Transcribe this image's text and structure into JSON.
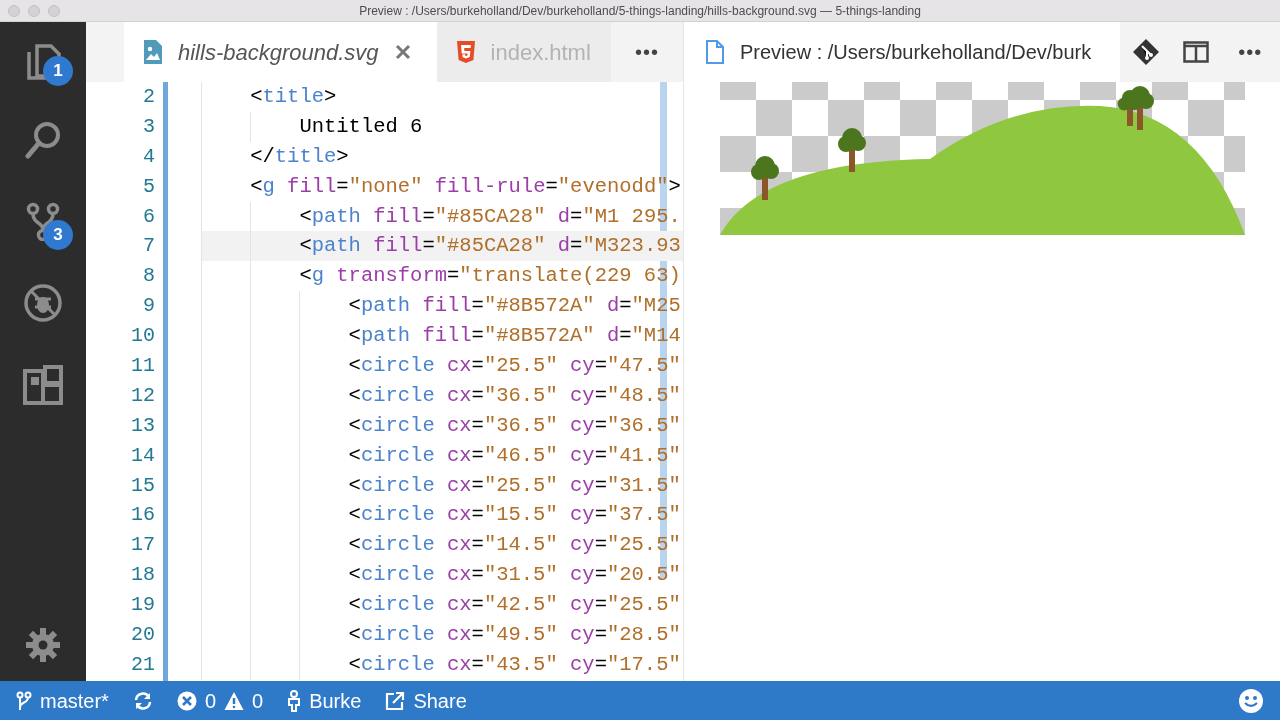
{
  "window": {
    "title": "Preview : /Users/burkeholland/Dev/burkeholland/5-things-landing/hills-background.svg — 5-things-landing"
  },
  "activity_bar": {
    "items": [
      {
        "kind": "files",
        "badge": "1"
      },
      {
        "kind": "search"
      },
      {
        "kind": "scm",
        "badge": "3"
      },
      {
        "kind": "debug"
      },
      {
        "kind": "extensions"
      }
    ]
  },
  "editor": {
    "tabs": [
      {
        "label": "hills-background.svg",
        "kind": "image",
        "selected": true,
        "preview": true
      },
      {
        "label": "index.html",
        "kind": "html",
        "selected": false,
        "preview": false
      }
    ],
    "more": "•••",
    "lines": [
      {
        "number": "2",
        "tokens": [
          {
            "kind": "p",
            "s": "<"
          },
          {
            "kind": "tag",
            "s": "title"
          },
          {
            "kind": "p",
            "s": ">"
          }
        ],
        "children": [
          {
            "number": "3",
            "tokens": [
              {
                "kind": "text",
                "s": "Untitled 6"
              }
            ]
          }
        ]
      },
      {
        "number": "4",
        "tokens": [
          {
            "kind": "p",
            "s": "</"
          },
          {
            "kind": "tag",
            "s": "title"
          },
          {
            "kind": "p",
            "s": ">"
          }
        ]
      },
      {
        "number": "5",
        "tokens": [
          {
            "kind": "p",
            "s": "<"
          },
          {
            "kind": "tag",
            "s": "g"
          },
          {
            "kind": "attr",
            "s": " fill"
          },
          {
            "kind": "p",
            "s": "="
          },
          {
            "kind": "str",
            "s": "\"none\""
          },
          {
            "kind": "attr",
            "s": " fill-rule"
          },
          {
            "kind": "p",
            "s": "="
          },
          {
            "kind": "str",
            "s": "\"evenodd\""
          },
          {
            "kind": "p",
            "s": ">"
          }
        ],
        "children": [
          {
            "number": "6",
            "tokens": [
              {
                "kind": "p",
                "s": "<"
              },
              {
                "kind": "tag",
                "s": "path"
              },
              {
                "kind": "attr",
                "s": " fill"
              },
              {
                "kind": "p",
                "s": "="
              },
              {
                "kind": "str",
                "s": "\"#85CA28\""
              },
              {
                "kind": "attr",
                "s": " d"
              },
              {
                "kind": "p",
                "s": "="
              },
              {
                "kind": "str",
                "s": "\"M1 295."
              }
            ]
          },
          {
            "number": "7",
            "current": true,
            "tokens": [
              {
                "kind": "p",
                "s": "<"
              },
              {
                "kind": "tag",
                "s": "path"
              },
              {
                "kind": "attr",
                "s": " fill"
              },
              {
                "kind": "p",
                "s": "="
              },
              {
                "kind": "str",
                "s": "\"#85CA28\""
              },
              {
                "kind": "attr",
                "s": " d"
              },
              {
                "kind": "p",
                "s": "="
              },
              {
                "kind": "str",
                "s": "\"M323.93"
              }
            ]
          },
          {
            "number": "8",
            "tokens": [
              {
                "kind": "p",
                "s": "<"
              },
              {
                "kind": "tag",
                "s": "g"
              },
              {
                "kind": "attr",
                "s": " transform"
              },
              {
                "kind": "p",
                "s": "="
              },
              {
                "kind": "str",
                "s": "\"translate(229 63)"
              }
            ],
            "children": [
              {
                "number": "9",
                "tokens": [
                  {
                    "kind": "p",
                    "s": "<"
                  },
                  {
                    "kind": "tag",
                    "s": "path"
                  },
                  {
                    "kind": "attr",
                    "s": " fill"
                  },
                  {
                    "kind": "p",
                    "s": "="
                  },
                  {
                    "kind": "str",
                    "s": "\"#8B572A\""
                  },
                  {
                    "kind": "attr",
                    "s": " d"
                  },
                  {
                    "kind": "p",
                    "s": "="
                  },
                  {
                    "kind": "str",
                    "s": "\"M25"
                  }
                ]
              },
              {
                "number": "10",
                "tokens": [
                  {
                    "kind": "p",
                    "s": "<"
                  },
                  {
                    "kind": "tag",
                    "s": "path"
                  },
                  {
                    "kind": "attr",
                    "s": " fill"
                  },
                  {
                    "kind": "p",
                    "s": "="
                  },
                  {
                    "kind": "str",
                    "s": "\"#8B572A\""
                  },
                  {
                    "kind": "attr",
                    "s": " d"
                  },
                  {
                    "kind": "p",
                    "s": "="
                  },
                  {
                    "kind": "str",
                    "s": "\"M14"
                  }
                ]
              },
              {
                "number": "11",
                "tokens": [
                  {
                    "kind": "p",
                    "s": "<"
                  },
                  {
                    "kind": "tag",
                    "s": "circle"
                  },
                  {
                    "kind": "attr",
                    "s": " cx"
                  },
                  {
                    "kind": "p",
                    "s": "="
                  },
                  {
                    "kind": "str",
                    "s": "\"25.5\""
                  },
                  {
                    "kind": "attr",
                    "s": " cy"
                  },
                  {
                    "kind": "p",
                    "s": "="
                  },
                  {
                    "kind": "str",
                    "s": "\"47.5\""
                  }
                ]
              },
              {
                "number": "12",
                "tokens": [
                  {
                    "kind": "p",
                    "s": "<"
                  },
                  {
                    "kind": "tag",
                    "s": "circle"
                  },
                  {
                    "kind": "attr",
                    "s": " cx"
                  },
                  {
                    "kind": "p",
                    "s": "="
                  },
                  {
                    "kind": "str",
                    "s": "\"36.5\""
                  },
                  {
                    "kind": "attr",
                    "s": " cy"
                  },
                  {
                    "kind": "p",
                    "s": "="
                  },
                  {
                    "kind": "str",
                    "s": "\"48.5\""
                  }
                ]
              },
              {
                "number": "13",
                "tokens": [
                  {
                    "kind": "p",
                    "s": "<"
                  },
                  {
                    "kind": "tag",
                    "s": "circle"
                  },
                  {
                    "kind": "attr",
                    "s": " cx"
                  },
                  {
                    "kind": "p",
                    "s": "="
                  },
                  {
                    "kind": "str",
                    "s": "\"36.5\""
                  },
                  {
                    "kind": "attr",
                    "s": " cy"
                  },
                  {
                    "kind": "p",
                    "s": "="
                  },
                  {
                    "kind": "str",
                    "s": "\"36.5\""
                  }
                ]
              },
              {
                "number": "14",
                "tokens": [
                  {
                    "kind": "p",
                    "s": "<"
                  },
                  {
                    "kind": "tag",
                    "s": "circle"
                  },
                  {
                    "kind": "attr",
                    "s": " cx"
                  },
                  {
                    "kind": "p",
                    "s": "="
                  },
                  {
                    "kind": "str",
                    "s": "\"46.5\""
                  },
                  {
                    "kind": "attr",
                    "s": " cy"
                  },
                  {
                    "kind": "p",
                    "s": "="
                  },
                  {
                    "kind": "str",
                    "s": "\"41.5\""
                  }
                ]
              },
              {
                "number": "15",
                "tokens": [
                  {
                    "kind": "p",
                    "s": "<"
                  },
                  {
                    "kind": "tag",
                    "s": "circle"
                  },
                  {
                    "kind": "attr",
                    "s": " cx"
                  },
                  {
                    "kind": "p",
                    "s": "="
                  },
                  {
                    "kind": "str",
                    "s": "\"25.5\""
                  },
                  {
                    "kind": "attr",
                    "s": " cy"
                  },
                  {
                    "kind": "p",
                    "s": "="
                  },
                  {
                    "kind": "str",
                    "s": "\"31.5\""
                  }
                ]
              },
              {
                "number": "16",
                "tokens": [
                  {
                    "kind": "p",
                    "s": "<"
                  },
                  {
                    "kind": "tag",
                    "s": "circle"
                  },
                  {
                    "kind": "attr",
                    "s": " cx"
                  },
                  {
                    "kind": "p",
                    "s": "="
                  },
                  {
                    "kind": "str",
                    "s": "\"15.5\""
                  },
                  {
                    "kind": "attr",
                    "s": " cy"
                  },
                  {
                    "kind": "p",
                    "s": "="
                  },
                  {
                    "kind": "str",
                    "s": "\"37.5\""
                  }
                ]
              },
              {
                "number": "17",
                "tokens": [
                  {
                    "kind": "p",
                    "s": "<"
                  },
                  {
                    "kind": "tag",
                    "s": "circle"
                  },
                  {
                    "kind": "attr",
                    "s": " cx"
                  },
                  {
                    "kind": "p",
                    "s": "="
                  },
                  {
                    "kind": "str",
                    "s": "\"14.5\""
                  },
                  {
                    "kind": "attr",
                    "s": " cy"
                  },
                  {
                    "kind": "p",
                    "s": "="
                  },
                  {
                    "kind": "str",
                    "s": "\"25.5\""
                  }
                ]
              },
              {
                "number": "18",
                "tokens": [
                  {
                    "kind": "p",
                    "s": "<"
                  },
                  {
                    "kind": "tag",
                    "s": "circle"
                  },
                  {
                    "kind": "attr",
                    "s": " cx"
                  },
                  {
                    "kind": "p",
                    "s": "="
                  },
                  {
                    "kind": "str",
                    "s": "\"31.5\""
                  },
                  {
                    "kind": "attr",
                    "s": " cy"
                  },
                  {
                    "kind": "p",
                    "s": "="
                  },
                  {
                    "kind": "str",
                    "s": "\"20.5\""
                  }
                ]
              },
              {
                "number": "19",
                "tokens": [
                  {
                    "kind": "p",
                    "s": "<"
                  },
                  {
                    "kind": "tag",
                    "s": "circle"
                  },
                  {
                    "kind": "attr",
                    "s": " cx"
                  },
                  {
                    "kind": "p",
                    "s": "="
                  },
                  {
                    "kind": "str",
                    "s": "\"42.5\""
                  },
                  {
                    "kind": "attr",
                    "s": " cy"
                  },
                  {
                    "kind": "p",
                    "s": "="
                  },
                  {
                    "kind": "str",
                    "s": "\"25.5\""
                  }
                ]
              },
              {
                "number": "20",
                "tokens": [
                  {
                    "kind": "p",
                    "s": "<"
                  },
                  {
                    "kind": "tag",
                    "s": "circle"
                  },
                  {
                    "kind": "attr",
                    "s": " cx"
                  },
                  {
                    "kind": "p",
                    "s": "="
                  },
                  {
                    "kind": "str",
                    "s": "\"49.5\""
                  },
                  {
                    "kind": "attr",
                    "s": " cy"
                  },
                  {
                    "kind": "p",
                    "s": "="
                  },
                  {
                    "kind": "str",
                    "s": "\"28.5\""
                  }
                ]
              },
              {
                "number": "21",
                "tokens": [
                  {
                    "kind": "p",
                    "s": "<"
                  },
                  {
                    "kind": "tag",
                    "s": "circle"
                  },
                  {
                    "kind": "attr",
                    "s": " cx"
                  },
                  {
                    "kind": "p",
                    "s": "="
                  },
                  {
                    "kind": "str",
                    "s": "\"43.5\""
                  },
                  {
                    "kind": "attr",
                    "s": " cy"
                  },
                  {
                    "kind": "p",
                    "s": "="
                  },
                  {
                    "kind": "str",
                    "s": "\"17.5\""
                  }
                ]
              }
            ]
          }
        ]
      }
    ]
  },
  "preview": {
    "title": "Preview : /Users/burkeholland/Dev/burk",
    "actions": [
      {
        "kind": "git"
      },
      {
        "kind": "split"
      },
      {
        "kind": "more",
        "label": "•••"
      }
    ]
  },
  "status_bar": {
    "branch": "master*",
    "errors": "0",
    "warnings": "0",
    "user": "Burke",
    "share": "Share"
  }
}
